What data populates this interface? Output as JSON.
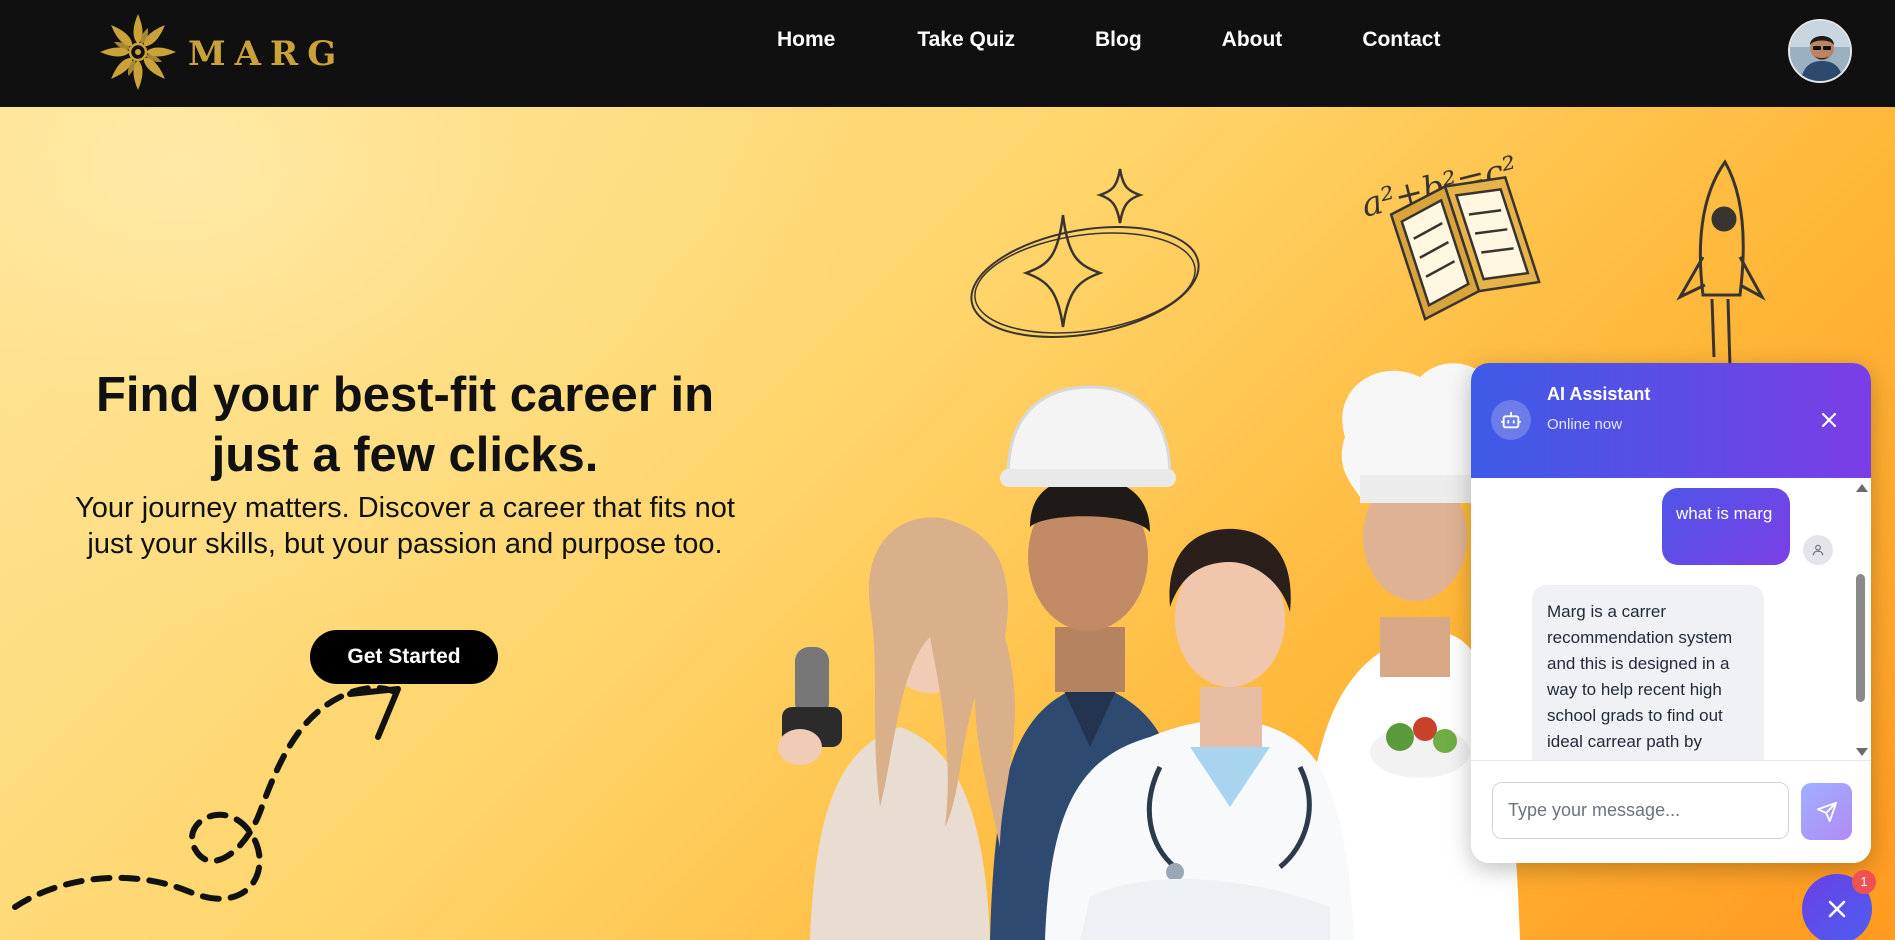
{
  "brand": {
    "name": "MARG"
  },
  "nav": {
    "items": [
      "Home",
      "Take Quiz",
      "Blog",
      "About",
      "Contact"
    ]
  },
  "hero": {
    "title": "Find your best-fit career in just a few clicks.",
    "subtitle": "Your journey matters. Discover a career that fits not just your skills, but your passion and purpose too.",
    "cta_label": "Get Started",
    "doodle_formula": "a²+b²=c²"
  },
  "chat": {
    "title": "AI Assistant",
    "status": "Online now",
    "messages": [
      {
        "from": "user",
        "text": "what is marg"
      },
      {
        "from": "bot",
        "text": "Marg is a carrer recommendation system and this is designed in a way to help recent high school grads to find out ideal carrear path by"
      }
    ],
    "input_placeholder": "Type your message..."
  },
  "fab": {
    "badge_count": "1"
  },
  "colors": {
    "nav_bg": "#111010",
    "brand_gold": "#c9a239",
    "chat_gradient_start": "#3d5be6",
    "chat_gradient_end": "#7b3ee6",
    "badge_red": "#f05252"
  },
  "icons": {
    "logo": "sun-flower-logo-icon",
    "chat_header": "robot-icon",
    "close": "close-icon",
    "send": "send-icon",
    "user": "user-icon"
  }
}
